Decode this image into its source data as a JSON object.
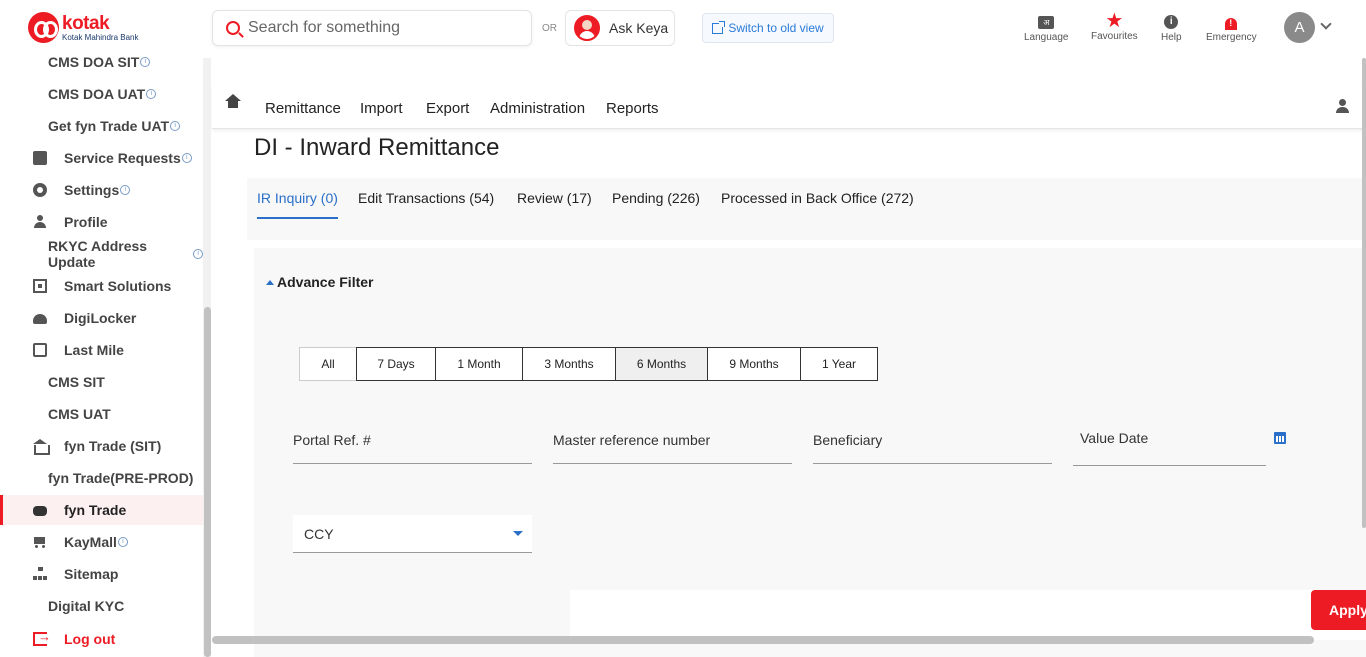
{
  "brand": {
    "name": "kotak",
    "sub": "Kotak Mahindra Bank"
  },
  "search": {
    "placeholder": "Search for something"
  },
  "or_label": "OR",
  "keya": {
    "label": "Ask Keya"
  },
  "switch_view": {
    "label": "Switch to old view"
  },
  "header_icons": {
    "language": "Language",
    "language_glyph": "अ",
    "favourites": "Favourites",
    "help": "Help",
    "emergency": "Emergency"
  },
  "user": {
    "initial": "A"
  },
  "sidebar": {
    "items": [
      {
        "label": "CMS DOA SIT",
        "info": true
      },
      {
        "label": "CMS DOA UAT",
        "info": true
      },
      {
        "label": "Get fyn Trade UAT",
        "info": true
      },
      {
        "label": "Service Requests",
        "icon": "service-requests-icon",
        "info": true
      },
      {
        "label": "Settings",
        "icon": "gear-icon",
        "info": true
      },
      {
        "label": "Profile",
        "icon": "profile-icon"
      },
      {
        "label": "RKYC Address Update",
        "info": true
      },
      {
        "label": "Smart Solutions",
        "icon": "smart-solutions-icon"
      },
      {
        "label": "DigiLocker",
        "icon": "cloud-icon"
      },
      {
        "label": "Last Mile",
        "icon": "wallet-icon"
      },
      {
        "label": "CMS SIT"
      },
      {
        "label": "CMS UAT"
      },
      {
        "label": "fyn Trade (SIT)",
        "icon": "bank-icon"
      },
      {
        "label": "fyn Trade(PRE-PROD)"
      },
      {
        "label": "fyn Trade",
        "icon": "handshake-icon",
        "active": true
      },
      {
        "label": "KayMall",
        "icon": "cart-icon",
        "info": true
      },
      {
        "label": "Sitemap",
        "icon": "sitemap-icon"
      },
      {
        "label": "Digital KYC"
      },
      {
        "label": "Log out",
        "icon": "logout-icon"
      }
    ]
  },
  "nav": {
    "items": [
      "Remittance",
      "Import",
      "Export",
      "Administration",
      "Reports"
    ]
  },
  "page": {
    "title": "DI - Inward Remittance"
  },
  "tabs": [
    {
      "label": "IR Inquiry (0)",
      "active": true
    },
    {
      "label": "Edit Transactions (54)"
    },
    {
      "label": "Review (17)"
    },
    {
      "label": "Pending (226)"
    },
    {
      "label": "Processed in Back Office (272)"
    }
  ],
  "filter": {
    "title": "Advance Filter",
    "periods": [
      "All",
      "7 Days",
      "1 Month",
      "3 Months",
      "6 Months",
      "9 Months",
      "1 Year"
    ],
    "selected_period": "6 Months",
    "fields": {
      "portal_ref": "Portal Ref. #",
      "master_ref": "Master reference number",
      "beneficiary": "Beneficiary",
      "value_date": "Value Date"
    },
    "ccy": {
      "placeholder": "CCY"
    },
    "apply_label": "Apply"
  },
  "colors": {
    "brand": "#ed1c24",
    "accent": "#2a6fc8"
  }
}
